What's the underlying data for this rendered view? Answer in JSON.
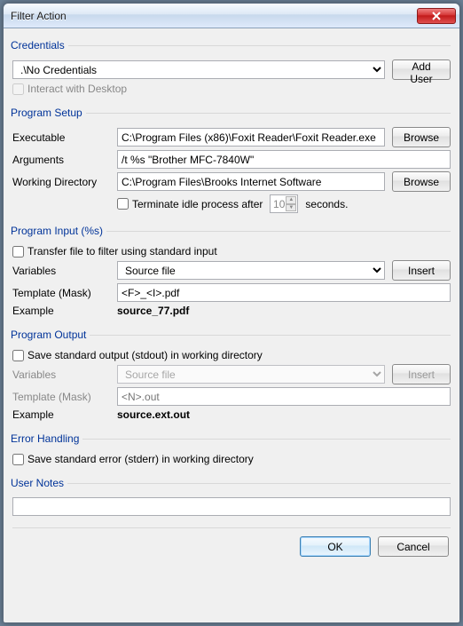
{
  "window": {
    "title": "Filter Action"
  },
  "credentials": {
    "legend": "Credentials",
    "selected": ".\\No Credentials",
    "add_user": "Add User",
    "interact_label": "Interact with Desktop"
  },
  "program_setup": {
    "legend": "Program Setup",
    "executable_label": "Executable",
    "executable_value": "C:\\Program Files (x86)\\Foxit Reader\\Foxit Reader.exe",
    "browse": "Browse",
    "arguments_label": "Arguments",
    "arguments_value": "/t %s \"Brother MFC-7840W\"",
    "workdir_label": "Working Directory",
    "workdir_value": "C:\\Program Files\\Brooks Internet Software",
    "terminate_label": "Terminate idle process after",
    "terminate_value": "10",
    "terminate_suffix": "seconds."
  },
  "program_input": {
    "legend": "Program Input (%s)",
    "transfer_label": "Transfer file to filter using standard input",
    "variables_label": "Variables",
    "variables_value": "Source file",
    "insert": "Insert",
    "template_label": "Template (Mask)",
    "template_value": "<F>_<I>.pdf",
    "example_label": "Example",
    "example_value": "source_77.pdf"
  },
  "program_output": {
    "legend": "Program Output",
    "save_stdout_label": "Save standard output (stdout) in working directory",
    "variables_label": "Variables",
    "variables_value": "Source file",
    "insert": "Insert",
    "template_label": "Template (Mask)",
    "template_placeholder": "<N>.out",
    "example_label": "Example",
    "example_value": "source.ext.out"
  },
  "error_handling": {
    "legend": "Error Handling",
    "save_stderr_label": "Save standard error (stderr) in working directory"
  },
  "user_notes": {
    "legend": "User Notes"
  },
  "footer": {
    "ok": "OK",
    "cancel": "Cancel"
  }
}
